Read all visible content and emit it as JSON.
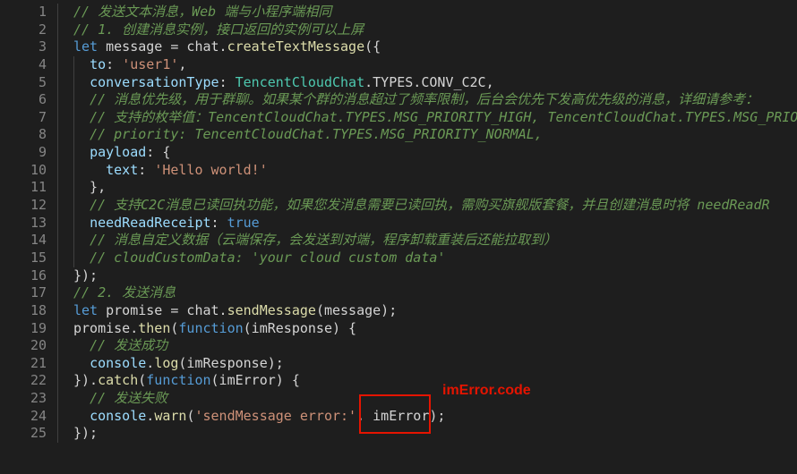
{
  "line_numbers": [
    "1",
    "2",
    "3",
    "4",
    "5",
    "6",
    "7",
    "8",
    "9",
    "10",
    "11",
    "12",
    "13",
    "14",
    "15",
    "16",
    "17",
    "18",
    "19",
    "20",
    "21",
    "22",
    "23",
    "24",
    "25"
  ],
  "lines": [
    [
      [
        "c",
        "// 发送文本消息，Web 端与小程序端相同"
      ]
    ],
    [
      [
        "c",
        "// 1. 创建消息实例，接口返回的实例可以上屏"
      ]
    ],
    [
      [
        "k",
        "let"
      ],
      [
        "p",
        " message = chat."
      ],
      [
        "f",
        "createTextMessage"
      ],
      [
        "p",
        "({"
      ]
    ],
    [
      [
        "p",
        "  "
      ],
      [
        "v",
        "to"
      ],
      [
        "p",
        ": "
      ],
      [
        "s",
        "'user1'"
      ],
      [
        "p",
        ","
      ]
    ],
    [
      [
        "p",
        "  "
      ],
      [
        "v",
        "conversationType"
      ],
      [
        "p",
        ": "
      ],
      [
        "t",
        "TencentCloudChat"
      ],
      [
        "p",
        ".TYPES.CONV_C2C,"
      ]
    ],
    [
      [
        "p",
        "  "
      ],
      [
        "c",
        "// 消息优先级，用于群聊。如果某个群的消息超过了频率限制，后台会优先下发高优先级的消息，详细请参考："
      ]
    ],
    [
      [
        "p",
        "  "
      ],
      [
        "c",
        "// 支持的枚举值：TencentCloudChat.TYPES.MSG_PRIORITY_HIGH, TencentCloudChat.TYPES.MSG_PRIOR"
      ]
    ],
    [
      [
        "p",
        "  "
      ],
      [
        "c",
        "// priority: TencentCloudChat.TYPES.MSG_PRIORITY_NORMAL,"
      ]
    ],
    [
      [
        "p",
        "  "
      ],
      [
        "v",
        "payload"
      ],
      [
        "p",
        ": {"
      ]
    ],
    [
      [
        "p",
        "    "
      ],
      [
        "v",
        "text"
      ],
      [
        "p",
        ": "
      ],
      [
        "s",
        "'Hello world!'"
      ]
    ],
    [
      [
        "p",
        "  },"
      ]
    ],
    [
      [
        "p",
        "  "
      ],
      [
        "c",
        "// 支持C2C消息已读回执功能，如果您发消息需要已读回执，需购买旗舰版套餐，并且创建消息时将 needReadR"
      ]
    ],
    [
      [
        "p",
        "  "
      ],
      [
        "v",
        "needReadReceipt"
      ],
      [
        "p",
        ": "
      ],
      [
        "k",
        "true"
      ]
    ],
    [
      [
        "p",
        "  "
      ],
      [
        "c",
        "// 消息自定义数据（云端保存，会发送到对端，程序卸载重装后还能拉取到）"
      ]
    ],
    [
      [
        "p",
        "  "
      ],
      [
        "c",
        "// cloudCustomData: 'your cloud custom data'"
      ]
    ],
    [
      [
        "p",
        "});"
      ]
    ],
    [
      [
        "c",
        "// 2. 发送消息"
      ]
    ],
    [
      [
        "k",
        "let"
      ],
      [
        "p",
        " promise = chat."
      ],
      [
        "f",
        "sendMessage"
      ],
      [
        "p",
        "(message);"
      ]
    ],
    [
      [
        "p",
        "promise."
      ],
      [
        "f",
        "then"
      ],
      [
        "p",
        "("
      ],
      [
        "k",
        "function"
      ],
      [
        "p",
        "(imResponse) {"
      ]
    ],
    [
      [
        "p",
        "  "
      ],
      [
        "c",
        "// 发送成功"
      ]
    ],
    [
      [
        "p",
        "  "
      ],
      [
        "v",
        "console"
      ],
      [
        "p",
        "."
      ],
      [
        "f",
        "log"
      ],
      [
        "p",
        "(imResponse);"
      ]
    ],
    [
      [
        "p",
        "})."
      ],
      [
        "f",
        "catch"
      ],
      [
        "p",
        "("
      ],
      [
        "k",
        "function"
      ],
      [
        "p",
        "(imError) {"
      ]
    ],
    [
      [
        "p",
        "  "
      ],
      [
        "c",
        "// 发送失败"
      ]
    ],
    [
      [
        "p",
        "  "
      ],
      [
        "v",
        "console"
      ],
      [
        "p",
        "."
      ],
      [
        "f",
        "warn"
      ],
      [
        "p",
        "("
      ],
      [
        "s",
        "'sendMessage error:'"
      ],
      [
        "p",
        ", imError);"
      ]
    ],
    [
      [
        "p",
        "});"
      ]
    ]
  ],
  "annotation": {
    "label": "imError.code",
    "color": "#e51400"
  },
  "colors": {
    "background": "#1e1e1e",
    "comment": "#6a9955",
    "keyword": "#569cd6",
    "function": "#dcdcaa",
    "string": "#ce9178",
    "class": "#4ec9b0",
    "property": "#9cdcfe"
  }
}
